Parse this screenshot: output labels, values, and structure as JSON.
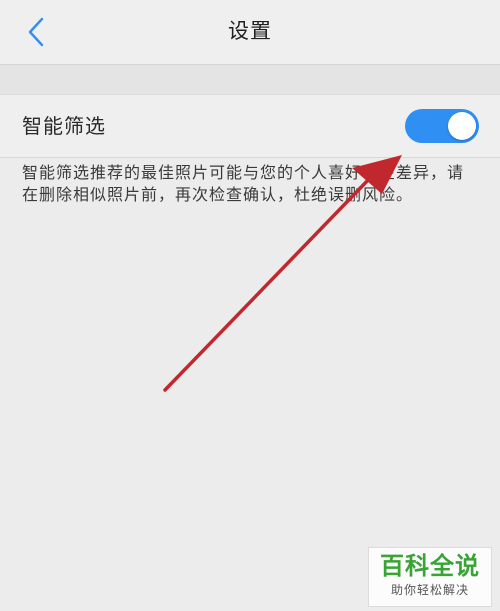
{
  "header": {
    "title": "设置",
    "back_icon": "chevron-left-icon"
  },
  "setting": {
    "label": "智能筛选",
    "toggle_on": true
  },
  "description": "智能筛选推荐的最佳照片可能与您的个人喜好存在差异，请在删除相似照片前，再次检查确认，杜绝误删风险。",
  "watermark": {
    "main": "百科全说",
    "sub": "助你轻松解决"
  },
  "colors": {
    "accent": "#2f8ff2",
    "arrow": "#c0282e",
    "watermark_green": "#3aa335"
  }
}
